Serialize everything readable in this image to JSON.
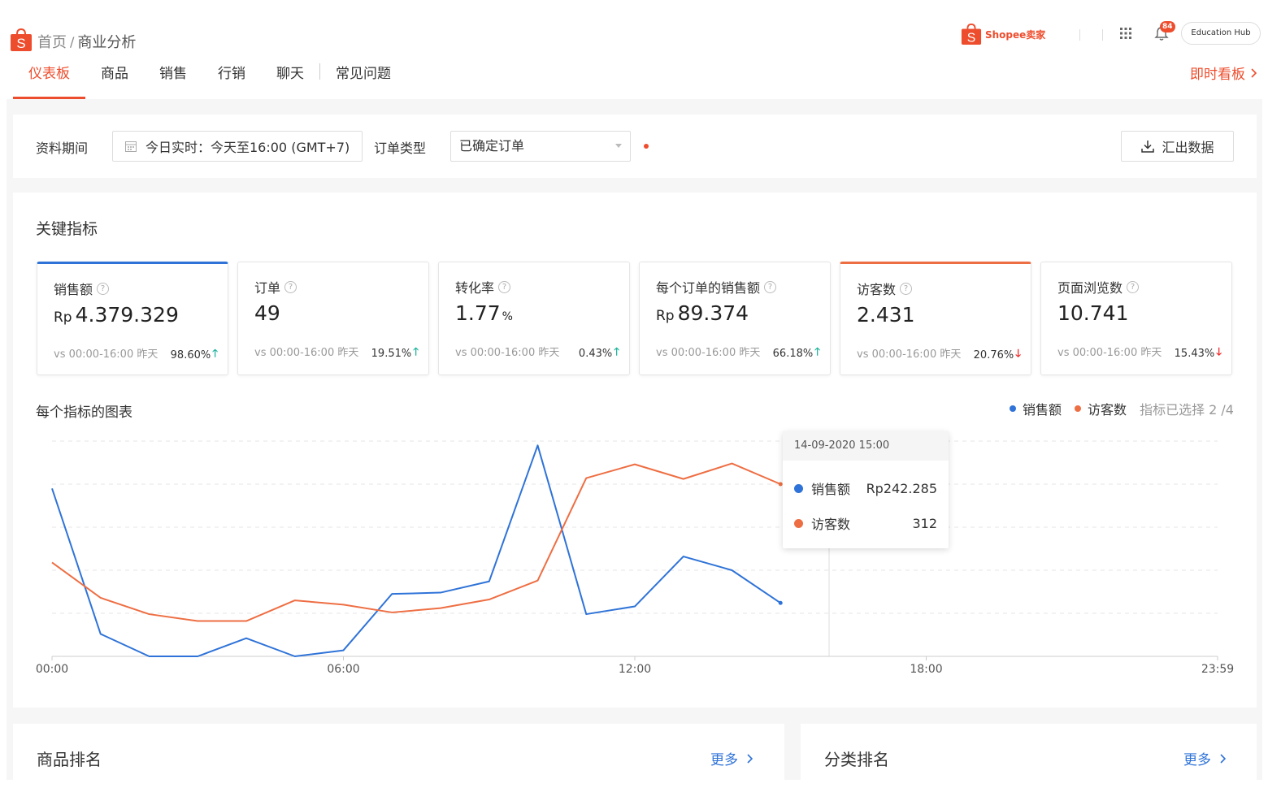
{
  "header": {
    "breadcrumb_home": "首页",
    "breadcrumb_sep": "/",
    "breadcrumb_current": "商业分析",
    "brand_text": "Shopee卖家",
    "notification_count": "84",
    "education_hub": "Education Hub",
    "realtime_link": "即时看板"
  },
  "nav": {
    "items": [
      "仪表板",
      "商品",
      "销售",
      "行销",
      "聊天",
      "常见问题"
    ],
    "active_index": 0
  },
  "filters": {
    "period_label": "资料期间",
    "period_value": "今日实时：今天至16:00 (GMT+7)",
    "order_type_label": "订单类型",
    "order_type_value": "已确定订单",
    "export_label": "汇出数据"
  },
  "key_metrics": {
    "title": "关键指标",
    "compare_text": "vs 00:00-16:00 昨天",
    "items": [
      {
        "label": "销售额",
        "currency": "Rp",
        "value": "4.379.329",
        "unit": "",
        "change": "98.60%",
        "direction": "up",
        "selected": "blue"
      },
      {
        "label": "订单",
        "currency": "",
        "value": "49",
        "unit": "",
        "change": "19.51%",
        "direction": "up",
        "selected": ""
      },
      {
        "label": "转化率",
        "currency": "",
        "value": "1.77",
        "unit": "%",
        "change": "0.43%",
        "direction": "up",
        "selected": ""
      },
      {
        "label": "每个订单的销售额",
        "currency": "Rp",
        "value": "89.374",
        "unit": "",
        "change": "66.18%",
        "direction": "up",
        "selected": ""
      },
      {
        "label": "访客数",
        "currency": "",
        "value": "2.431",
        "unit": "",
        "change": "20.76%",
        "direction": "down",
        "selected": "orange"
      },
      {
        "label": "页面浏览数",
        "currency": "",
        "value": "10.741",
        "unit": "",
        "change": "15.43%",
        "direction": "down",
        "selected": ""
      }
    ]
  },
  "chart": {
    "title": "每个指标的图表",
    "selected_note": "指标已选择 2 /4",
    "colors": {
      "sales": "#2f73d8",
      "visitors": "#ee6e43"
    }
  },
  "chart_data": {
    "type": "line",
    "x": [
      0,
      1,
      2,
      3,
      4,
      5,
      6,
      7,
      8,
      9,
      10,
      11,
      12,
      13,
      14,
      15
    ],
    "x_tick_labels": [
      "00:00",
      "06:00",
      "12:00",
      "18:00",
      "23:59"
    ],
    "x_range": [
      0,
      24
    ],
    "series": [
      {
        "name": "销售额",
        "values": [
          390,
          52,
          0,
          0,
          42,
          0,
          14,
          145,
          148,
          174,
          490,
          98,
          116,
          232,
          200,
          124
        ]
      },
      {
        "name": "访客数",
        "values": [
          218,
          136,
          98,
          82,
          82,
          130,
          120,
          102,
          112,
          132,
          176,
          414,
          446,
          412,
          448,
          400
        ]
      }
    ],
    "tooltip": {
      "time": "14-09-2020 15:00",
      "rows": [
        {
          "name": "销售额",
          "value": "Rp242.285"
        },
        {
          "name": "访客数",
          "value": "312"
        }
      ]
    },
    "grid": true,
    "legend": "top-right"
  },
  "bottom": {
    "product_rank_title": "商品排名",
    "category_rank_title": "分类排名",
    "more_label": "更多"
  }
}
